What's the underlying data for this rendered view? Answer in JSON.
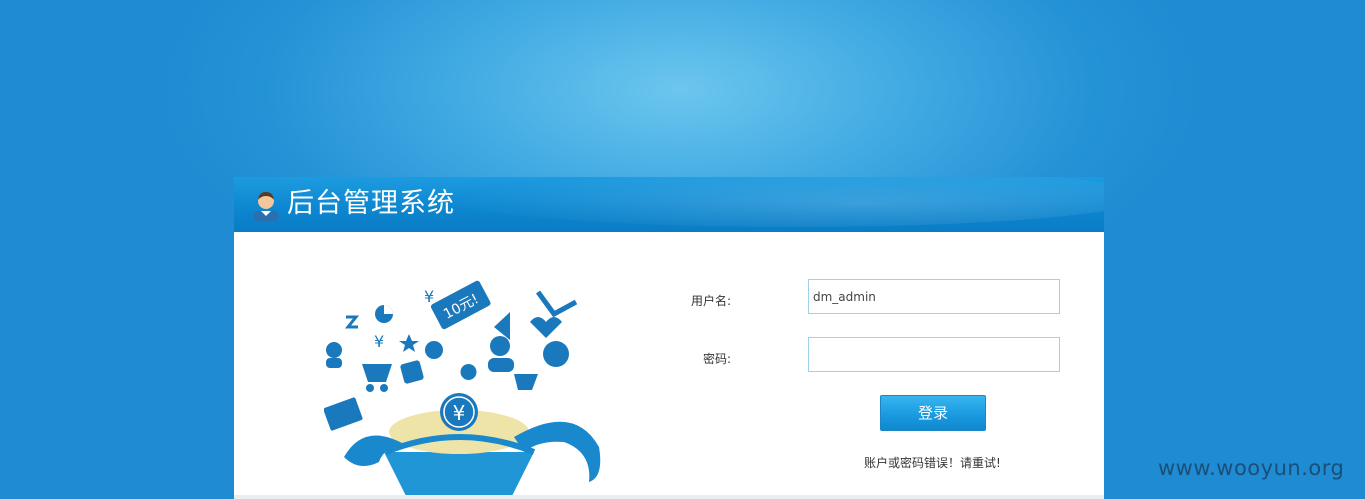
{
  "header": {
    "title": "后台管理系统",
    "icon": "user-avatar-icon"
  },
  "form": {
    "username_label": "用户名:",
    "username_value": "dm_admin",
    "password_label": "密码:",
    "password_value": "",
    "login_label": "登录",
    "error_message": "账户或密码错误！请重试!"
  },
  "illustration": {
    "coupon_text": "10元!",
    "coin_symbol": "¥"
  },
  "watermark": "www.wooyun.org",
  "colors": {
    "background": "#2592d6",
    "header": "#0c86cf",
    "button": "#1a9ae0",
    "input_border": "#9fd2e6"
  }
}
